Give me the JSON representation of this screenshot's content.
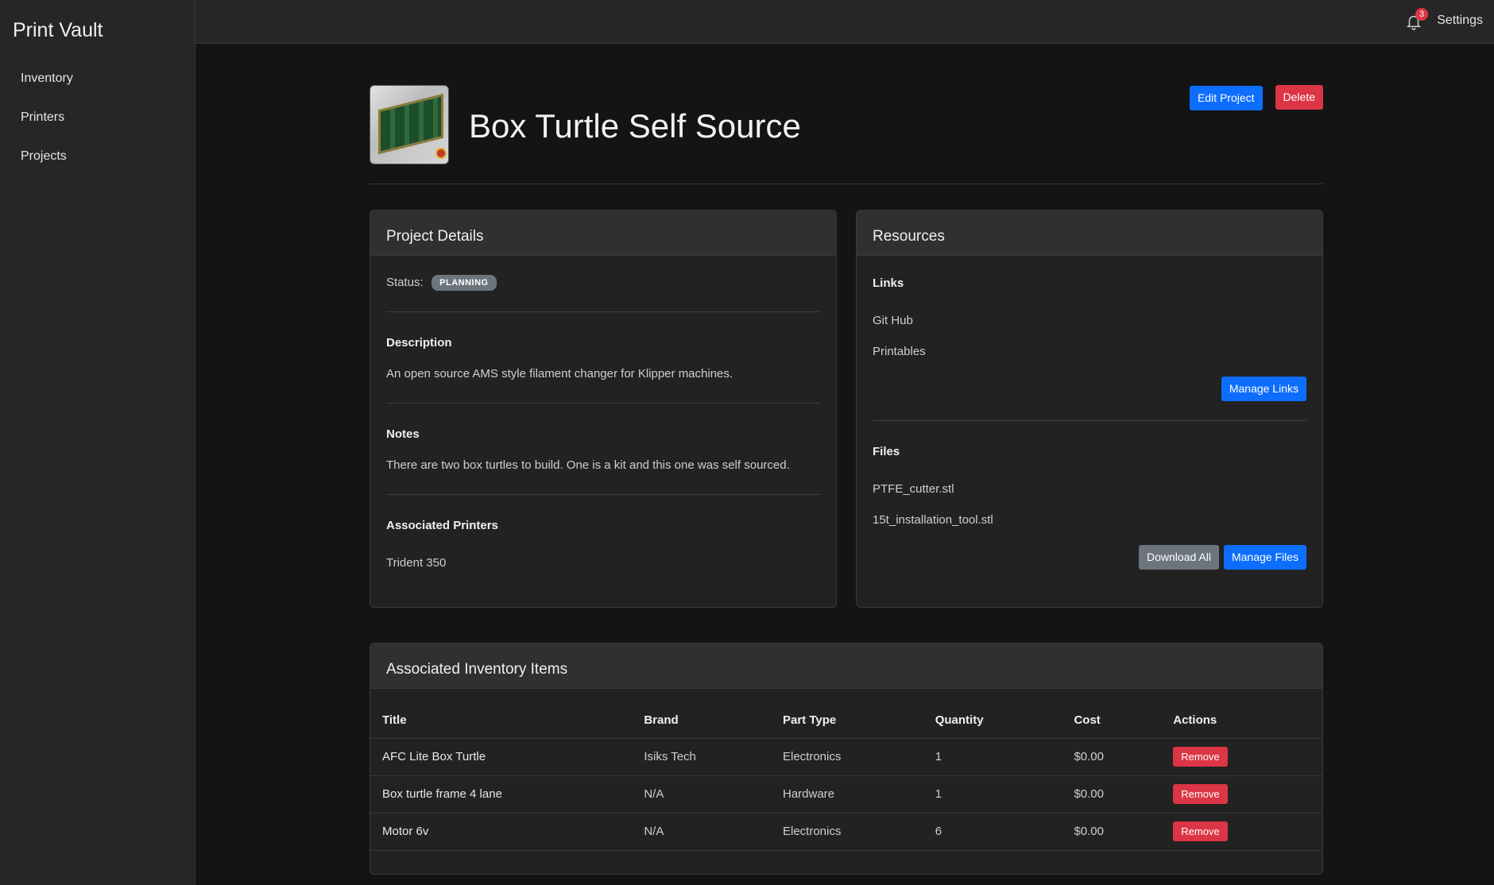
{
  "app": {
    "title": "Print Vault"
  },
  "sidebar": {
    "items": [
      {
        "label": "Inventory"
      },
      {
        "label": "Printers"
      },
      {
        "label": "Projects"
      }
    ]
  },
  "topbar": {
    "notification_count": "3",
    "settings_label": "Settings"
  },
  "project": {
    "title": "Box Turtle Self Source",
    "edit_label": "Edit Project",
    "delete_label": "Delete"
  },
  "details": {
    "header": "Project Details",
    "status_label": "Status:",
    "status_value": "PLANNING",
    "description_title": "Description",
    "description": "An open source AMS style filament changer for Klipper machines.",
    "notes_title": "Notes",
    "notes": "There are two box turtles to build. One is a kit and this one was self sourced.",
    "printers_title": "Associated Printers",
    "printers": [
      "Trident 350"
    ]
  },
  "resources": {
    "header": "Resources",
    "links_title": "Links",
    "links": [
      "Git Hub",
      "Printables"
    ],
    "manage_links_label": "Manage Links",
    "files_title": "Files",
    "files": [
      "PTFE_cutter.stl",
      "15t_installation_tool.stl"
    ],
    "download_all_label": "Download All",
    "manage_files_label": "Manage Files"
  },
  "inventory": {
    "header": "Associated Inventory Items",
    "columns": [
      "Title",
      "Brand",
      "Part Type",
      "Quantity",
      "Cost",
      "Actions"
    ],
    "rows": [
      {
        "title": "AFC Lite Box Turtle",
        "brand": "Isiks Tech",
        "part_type": "Electronics",
        "quantity": "1",
        "cost": "$0.00",
        "action": "Remove"
      },
      {
        "title": "Box turtle frame 4 lane",
        "brand": "N/A",
        "part_type": "Hardware",
        "quantity": "1",
        "cost": "$0.00",
        "action": "Remove"
      },
      {
        "title": "Motor 6v",
        "brand": "N/A",
        "part_type": "Electronics",
        "quantity": "6",
        "cost": "$0.00",
        "action": "Remove"
      }
    ]
  }
}
